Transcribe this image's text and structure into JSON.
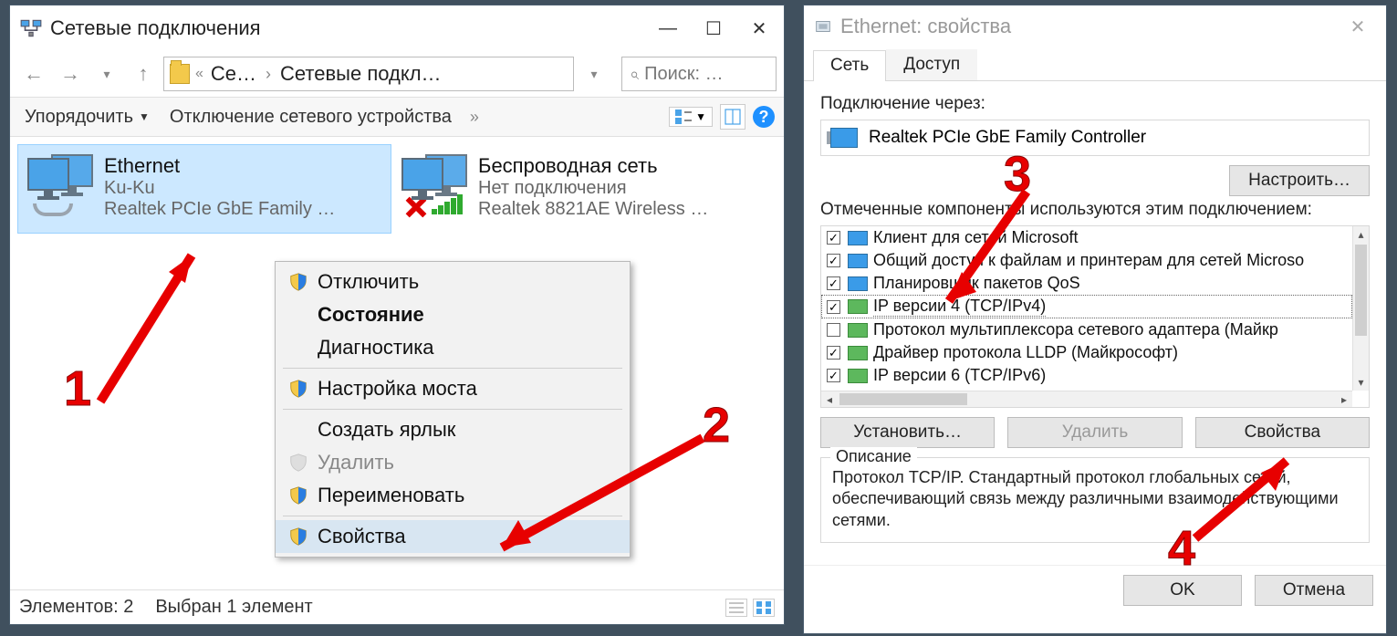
{
  "win1": {
    "title": "Сетевые подключения",
    "nav": {
      "breadcrumb1": "Се…",
      "breadcrumb2": "Сетевые подкл…",
      "search_placeholder": "Поиск: …"
    },
    "toolbar": {
      "organize": "Упорядочить",
      "disable": "Отключение сетевого устройства"
    },
    "connections": [
      {
        "name": "Ethernet",
        "sub1": "Ku-Ku",
        "sub2": "Realtek PCIe GbE Family …"
      },
      {
        "name": "Беспроводная сеть",
        "sub1": "Нет подключения",
        "sub2": "Realtek 8821AE Wireless …"
      }
    ],
    "context_menu": {
      "disable": "Отключить",
      "status": "Состояние",
      "diag": "Диагностика",
      "bridge": "Настройка моста",
      "make_shortcut": "Создать ярлык",
      "delete": "Удалить",
      "rename": "Переименовать",
      "properties": "Свойства"
    },
    "statusbar": {
      "elements": "Элементов: 2",
      "selected": "Выбран 1 элемент"
    }
  },
  "win2": {
    "title": "Ethernet: свойства",
    "tabs": {
      "net": "Сеть",
      "access": "Доступ"
    },
    "conn_through_label": "Подключение через:",
    "adapter": "Realtek PCIe GbE Family Controller",
    "configure": "Настроить…",
    "components_label": "Отмеченные компоненты используются этим подключением:",
    "components": [
      {
        "checked": true,
        "green": false,
        "text": "Клиент для сетей Microsoft"
      },
      {
        "checked": true,
        "green": false,
        "text": "Общий доступ к файлам и принтерам для сетей Microso"
      },
      {
        "checked": true,
        "green": false,
        "text": "Планировщик пакетов QoS"
      },
      {
        "checked": true,
        "green": true,
        "text": "IP версии 4 (TCP/IPv4)",
        "highlight": true
      },
      {
        "checked": false,
        "green": true,
        "text": "Протокол мультиплексора сетевого адаптера (Майкр"
      },
      {
        "checked": true,
        "green": true,
        "text": "Драйвер протокола LLDP (Майкрософт)"
      },
      {
        "checked": true,
        "green": true,
        "text": "IP версии 6 (TCP/IPv6)"
      }
    ],
    "buttons": {
      "install": "Установить…",
      "remove": "Удалить",
      "properties": "Свойства"
    },
    "desc_group": "Описание",
    "desc_text": "Протокол TCP/IP. Стандартный протокол глобальных сетей, обеспечивающий связь между различными взаимодействующими сетями.",
    "ok": "OK",
    "cancel": "Отмена"
  },
  "annotations": {
    "n1": "1",
    "n2": "2",
    "n3": "3",
    "n4": "4"
  }
}
